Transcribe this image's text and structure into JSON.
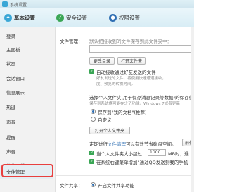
{
  "window": {
    "title": "系统设置"
  },
  "tabs": [
    {
      "label": "基本设置",
      "icon": "gear-icon",
      "color": "#3aa7d6",
      "active": true
    },
    {
      "label": "安全设置",
      "icon": "shield-check-icon",
      "color": "#3aa655",
      "active": false
    },
    {
      "label": "权限设置",
      "icon": "permission-icon",
      "color": "#2f6fb3",
      "active": false
    }
  ],
  "sidebar": {
    "items": [
      {
        "label": "登录"
      },
      {
        "label": "主面板"
      },
      {
        "label": "状态"
      },
      {
        "label": "会话窗口"
      },
      {
        "label": "信息展示"
      },
      {
        "label": "热键"
      },
      {
        "label": "声音"
      },
      {
        "label": "提醒"
      },
      {
        "label": "声音"
      },
      {
        "label": "软件更新"
      },
      {
        "label": "文件管理"
      }
    ],
    "highlighted_index": 10
  },
  "file_management": {
    "section_label": "文件管理：",
    "default_folder_text": "默认把接收到的文件保存到此文件夹中：",
    "change_dir_button": "更改目录",
    "open_folder_button": "打开文件夹",
    "auto_receive_label": "自动接收通过好友发送的文件",
    "auto_receive_desc_1": "好友发送的文件，将使用快速通道接收，",
    "auto_receive_desc_2": "度、预览的转换时间。",
    "personal_folder_text": "选择个人文件夹(用于保存消息记录等数据)的保存位",
    "personal_folder_desc": "保存到系统盘可能在少了功能，Windows 7或者更高",
    "option_mydocs": "保存到\"我的文档\"(推荐)",
    "option_custom": "自定义",
    "open_personal_button": "打开个人文件夹",
    "cleanup_text_prefix": "定期进行",
    "cleanup_link": "文件清理",
    "cleanup_text_suffix": "可以有效节省磁盘空间。",
    "cleanup_button": "前往",
    "max_file_label": "当个人文件夹大小超过",
    "max_file_value": "1000",
    "max_file_unit": "MB时，通",
    "store_mobile_label": "在系统右键菜单增加\"通过QQ发送到我的手机"
  },
  "file_sharing": {
    "section_label": "文件共享：",
    "enable_label": "开启文件共享功能"
  }
}
